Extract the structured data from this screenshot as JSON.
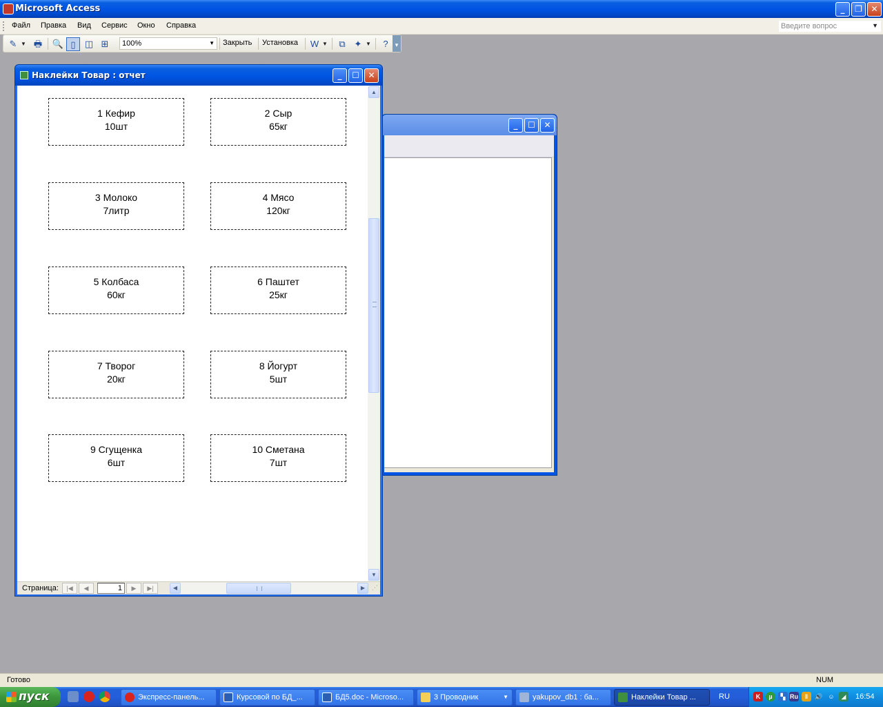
{
  "app": {
    "title": "Microsoft Access"
  },
  "menu": {
    "items": [
      "Файл",
      "Правка",
      "Вид",
      "Сервис",
      "Окно",
      "Справка"
    ],
    "ask_placeholder": "Введите вопрос"
  },
  "toolbar": {
    "zoom": "100%",
    "close_label": "Закрыть",
    "setup_label": "Установка"
  },
  "report_window": {
    "title": "Наклейки Товар : отчет",
    "labels": [
      {
        "name": "1 Кефир",
        "qty": "10шт"
      },
      {
        "name": "2 Сыр",
        "qty": "65кг"
      },
      {
        "name": "3 Молоко",
        "qty": "7литр"
      },
      {
        "name": "4 Мясо",
        "qty": "120кг"
      },
      {
        "name": "5 Колбаса",
        "qty": "60кг"
      },
      {
        "name": "6 Паштет",
        "qty": "25кг"
      },
      {
        "name": "7 Творог",
        "qty": "20кг"
      },
      {
        "name": "8 Йогурт",
        "qty": "5шт"
      },
      {
        "name": "9 Сгущенка",
        "qty": "6шт"
      },
      {
        "name": "10 Сметана",
        "qty": "7шт"
      }
    ],
    "nav": {
      "page_label": "Страница:",
      "page_number": "1"
    }
  },
  "status": {
    "text": "Готово",
    "num": "NUM"
  },
  "taskbar": {
    "start_label": "пуск",
    "tasks": [
      {
        "label": "Экспресс-панель...",
        "color": "#d9231f"
      },
      {
        "label": "Курсовой по БД_...",
        "color": "#2b5fb4"
      },
      {
        "label": "БД5.doc - Microso...",
        "color": "#2b5fb4"
      },
      {
        "label": "3 Проводник",
        "color": "#f3cf57"
      },
      {
        "label": "yakupov_db1 : ба...",
        "color": "#a0b4d8"
      },
      {
        "label": "Наклейки Товар ...",
        "color": "#3f8f3f"
      }
    ],
    "lang": "RU",
    "tray_lang": "Ru",
    "clock": "16:54"
  }
}
